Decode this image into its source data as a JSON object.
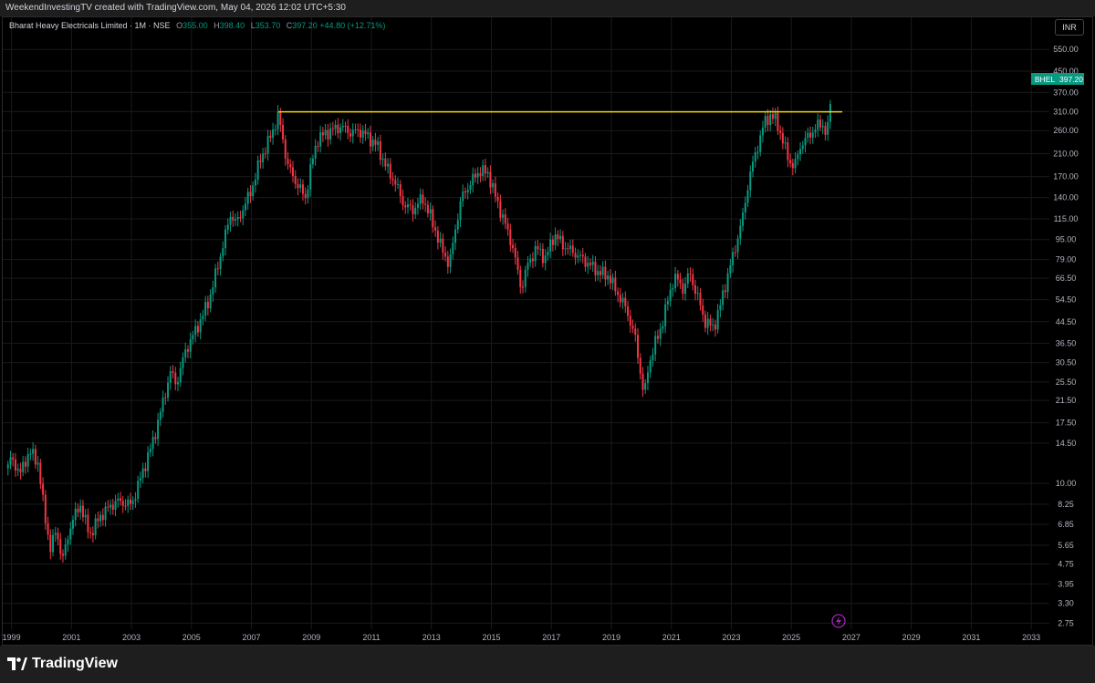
{
  "header": {
    "attribution": "WeekendInvestingTV created with TradingView.com, May 04, 2026 12:02 UTC+5:30"
  },
  "legend": {
    "symbol": "Bharat Heavy Electricals Limited · 1M · NSE",
    "o_label": "O",
    "o_value": "355.00",
    "h_label": "H",
    "h_value": "398.40",
    "l_label": "L",
    "l_value": "353.70",
    "c_label": "C",
    "c_value": "397.20",
    "change": "+44.80 (+12.71%)"
  },
  "currency": "INR",
  "price_tag": {
    "ticker": "BHEL",
    "value": "397.20"
  },
  "footer": {
    "brand": "TradingView"
  },
  "colors": {
    "up": "#089981",
    "down": "#f23645",
    "resistance": "#f5d300",
    "background": "#000000",
    "grid": "#1a1a1a",
    "accent": "#9c27b0"
  },
  "icons": {
    "logo": "tradingview-logo-icon",
    "lightning": "lightning-icon"
  },
  "chart_data": {
    "type": "candlestick",
    "timeframe": "1M",
    "y_scale": "log",
    "ylim": [
      2.6,
      620
    ],
    "xlim": [
      1998.8,
      2033.3
    ],
    "y_ticks": [
      "550.00",
      "450.00",
      "370.00",
      "310.00",
      "260.00",
      "210.00",
      "170.00",
      "140.00",
      "115.00",
      "95.00",
      "79.00",
      "66.50",
      "54.50",
      "44.50",
      "36.50",
      "30.50",
      "25.50",
      "21.50",
      "17.50",
      "14.50",
      "10.00",
      "8.25",
      "6.85",
      "5.65",
      "4.75",
      "3.95",
      "3.30",
      "2.75"
    ],
    "x_ticks": [
      "1999",
      "2001",
      "2003",
      "2005",
      "2007",
      "2009",
      "2011",
      "2013",
      "2015",
      "2017",
      "2019",
      "2021",
      "2023",
      "2025",
      "2027",
      "2029",
      "2031",
      "2033"
    ],
    "resistance_line": {
      "value": 309,
      "from": 2007.9,
      "to": 2026.7
    },
    "series": [
      {
        "x": [
          1998.8,
          1999.0,
          1999.3,
          1999.6,
          1999.9,
          2000.1,
          2000.3,
          2000.5,
          2000.7,
          2001.0,
          2001.3,
          2001.6,
          2002.0,
          2002.5,
          2003.0,
          2003.3,
          2003.7,
          2004.0,
          2004.3,
          2004.5,
          2004.8,
          2005.0,
          2005.3,
          2005.6,
          2006.0,
          2006.3,
          2006.5,
          2006.7,
          2007.0,
          2007.3,
          2007.6,
          2007.9,
          2008.2,
          2008.5,
          2008.8,
          2009.0,
          2009.2,
          2009.5,
          2009.8,
          2010.0,
          2010.3,
          2010.6,
          2010.9,
          2011.2,
          2011.5,
          2011.8,
          2012.1,
          2012.4,
          2012.7,
          2013.0,
          2013.3,
          2013.6,
          2013.8,
          2014.0,
          2014.3,
          2014.6,
          2014.9,
          2015.1,
          2015.4,
          2015.7,
          2016.0,
          2016.2,
          2016.5,
          2016.8,
          2017.1,
          2017.4,
          2017.7,
          2018.0,
          2018.3,
          2018.6,
          2018.9,
          2019.2,
          2019.5,
          2019.8,
          2020.1,
          2020.2,
          2020.4,
          2020.6,
          2020.9,
          2021.1,
          2021.4,
          2021.6,
          2021.9,
          2022.1,
          2022.4,
          2022.6,
          2022.9,
          2023.1,
          2023.4,
          2023.6,
          2023.9,
          2024.1,
          2024.3,
          2024.5,
          2024.7,
          2024.9,
          2025.1,
          2025.3,
          2025.6,
          2025.8,
          2026.0,
          2026.2,
          2026.35
        ],
        "close": [
          11.5,
          12.5,
          11.0,
          13.5,
          12.0,
          7.5,
          5.5,
          6.5,
          4.9,
          7.0,
          8.2,
          6.2,
          7.5,
          8.5,
          8.2,
          10.5,
          14.5,
          20,
          28,
          25,
          34,
          38,
          45,
          55,
          85,
          120,
          110,
          125,
          150,
          200,
          240,
          300,
          190,
          160,
          140,
          190,
          240,
          255,
          265,
          270,
          255,
          260,
          245,
          225,
          185,
          160,
          130,
          125,
          140,
          115,
          90,
          75,
          105,
          140,
          160,
          180,
          175,
          145,
          115,
          90,
          60,
          75,
          88,
          80,
          100,
          90,
          85,
          80,
          75,
          70,
          68,
          58,
          50,
          38,
          22,
          28,
          35,
          40,
          55,
          68,
          60,
          70,
          55,
          45,
          42,
          50,
          70,
          85,
          120,
          170,
          230,
          280,
          300,
          285,
          240,
          200,
          185,
          225,
          250,
          265,
          280,
          250,
          397.2
        ]
      }
    ]
  }
}
